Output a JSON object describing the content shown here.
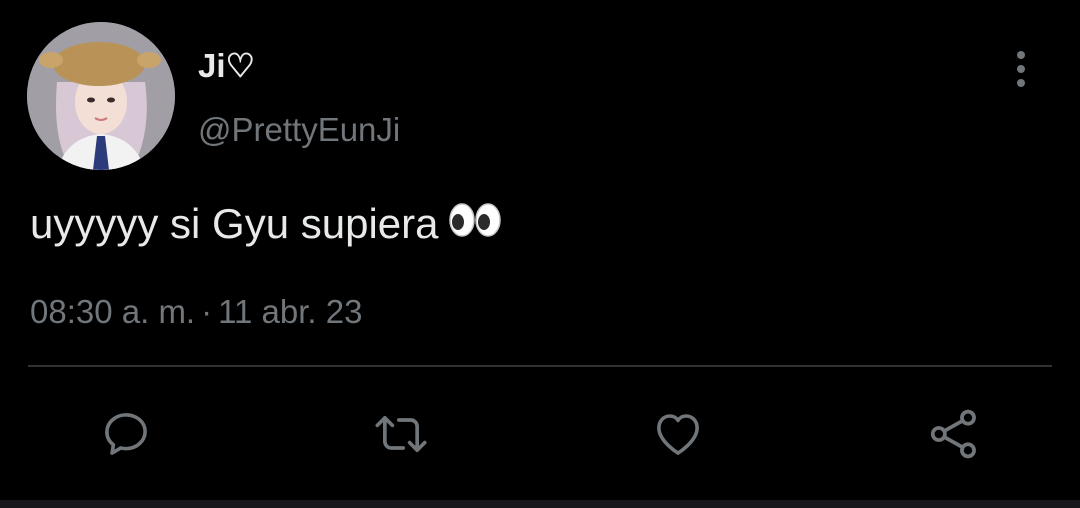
{
  "user": {
    "display_name": "Ji♡",
    "handle": "@PrettyEunJi"
  },
  "tweet": {
    "text": "uyyyyy si Gyu supiera",
    "emoji": "eyes",
    "time": "08:30 a. m.",
    "separator": "·",
    "date": "11 abr. 23"
  },
  "actions": [
    "reply-icon",
    "retweet-icon",
    "like-icon",
    "share-icon"
  ],
  "colors": {
    "background": "#000000",
    "primary_text": "#e7e9ea",
    "secondary_text": "#71767b",
    "divider": "#2f3336",
    "icon": "#71767b"
  }
}
